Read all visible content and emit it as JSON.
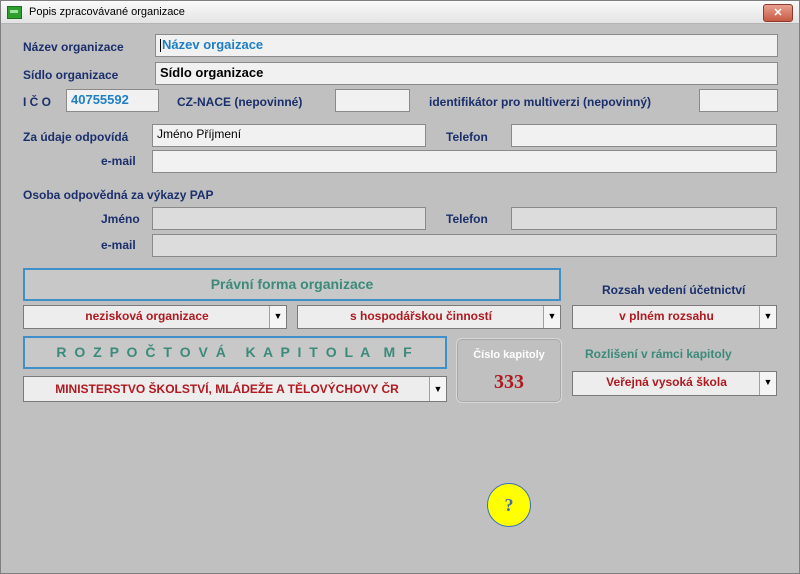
{
  "window": {
    "title": "Popis zpracovávané organizace",
    "close_label": "✕"
  },
  "org": {
    "name_label": "Název organizace",
    "name_value": "Název orgaizace",
    "seat_label": "Sídlo organizace",
    "seat_value": "Sídlo organizace",
    "ico_label": "I Č O",
    "ico_value": "40755592",
    "cznace_label": "CZ-NACE (nepovinné)",
    "cznace_value": "",
    "multiverze_label": "identifikátor pro multiverzi (nepovinný)",
    "multiverze_value": ""
  },
  "responsible": {
    "label": "Za údaje odpovídá",
    "name_value": "Jméno Příjmení",
    "phone_label": "Telefon",
    "phone_value": "",
    "email_label": "e-mail",
    "email_value": ""
  },
  "pap": {
    "heading": "Osoba odpovědná za výkazy PAP",
    "name_label": "Jméno",
    "name_value": "",
    "phone_label": "Telefon",
    "phone_value": "",
    "email_label": "e-mail",
    "email_value": ""
  },
  "legal_form": {
    "header": "Právní forma organizace",
    "type_value": "nezisková organizace",
    "activity_value": "s hospodářskou činností"
  },
  "accounting": {
    "label": "Rozsah vedení účetnictví",
    "value": "v plném rozsahu"
  },
  "budget": {
    "header": "R O Z P O Č T O V Á   K A P I T O L A  M F",
    "ministry_value": "MINISTERSTVO ŠKOLSTVÍ, MLÁDEŽE A TĚLOVÝCHOVY ČR"
  },
  "chapter": {
    "label": "Číslo kapitoly",
    "number": "333"
  },
  "distinction": {
    "label": "Rozlišení v rámci kapitoly",
    "value": "Veřejná vysoká škola"
  },
  "help": {
    "label": "?"
  },
  "colors": {
    "background": "#c0c0c0",
    "label_text": "#1a2f6b",
    "accent_blue": "#1f7fc4",
    "accent_red": "#b0191f",
    "help_yellow": "#ffff00"
  }
}
